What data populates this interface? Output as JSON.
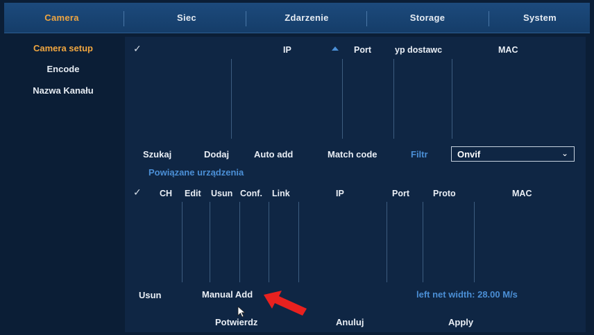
{
  "tabs": [
    {
      "label": "Camera",
      "active": true
    },
    {
      "label": "Siec"
    },
    {
      "label": "Zdarzenie"
    },
    {
      "label": "Storage"
    },
    {
      "label": "System"
    }
  ],
  "sidebar": {
    "items": [
      {
        "label": "Camera setup",
        "active": true
      },
      {
        "label": "Encode"
      },
      {
        "label": "Nazwa Kanału"
      }
    ]
  },
  "search_table": {
    "columns": [
      "IP",
      "Port",
      "yp dostawc",
      "MAC"
    ]
  },
  "toolbar": {
    "search": "Szukaj",
    "add": "Dodaj",
    "auto_add": "Auto add",
    "match_code": "Match code",
    "filter_label": "Filtr",
    "filter_value": "Onvif"
  },
  "linked_section": {
    "title": "Powiązane urządzenia",
    "columns": [
      "CH",
      "Edit",
      "Usun",
      "Conf.",
      "Link",
      "IP",
      "Port",
      "Proto",
      "MAC"
    ]
  },
  "bottom": {
    "delete": "Usun",
    "manual_add": "Manual Add",
    "bandwidth": "left net width:  28.00 M/s",
    "confirm": "Potwierdz",
    "cancel": "Anuluj",
    "apply": "Apply"
  },
  "colors": {
    "accent": "#f0a640",
    "link_blue": "#4b8fd6",
    "annotation_arrow": "#e8211f"
  },
  "icons": {
    "checkbox": "check-icon",
    "sort": "sort-up-icon",
    "dropdown": "chevron-down-icon",
    "cursor": "mouse-cursor-icon",
    "annotation": "red-arrow-icon"
  }
}
